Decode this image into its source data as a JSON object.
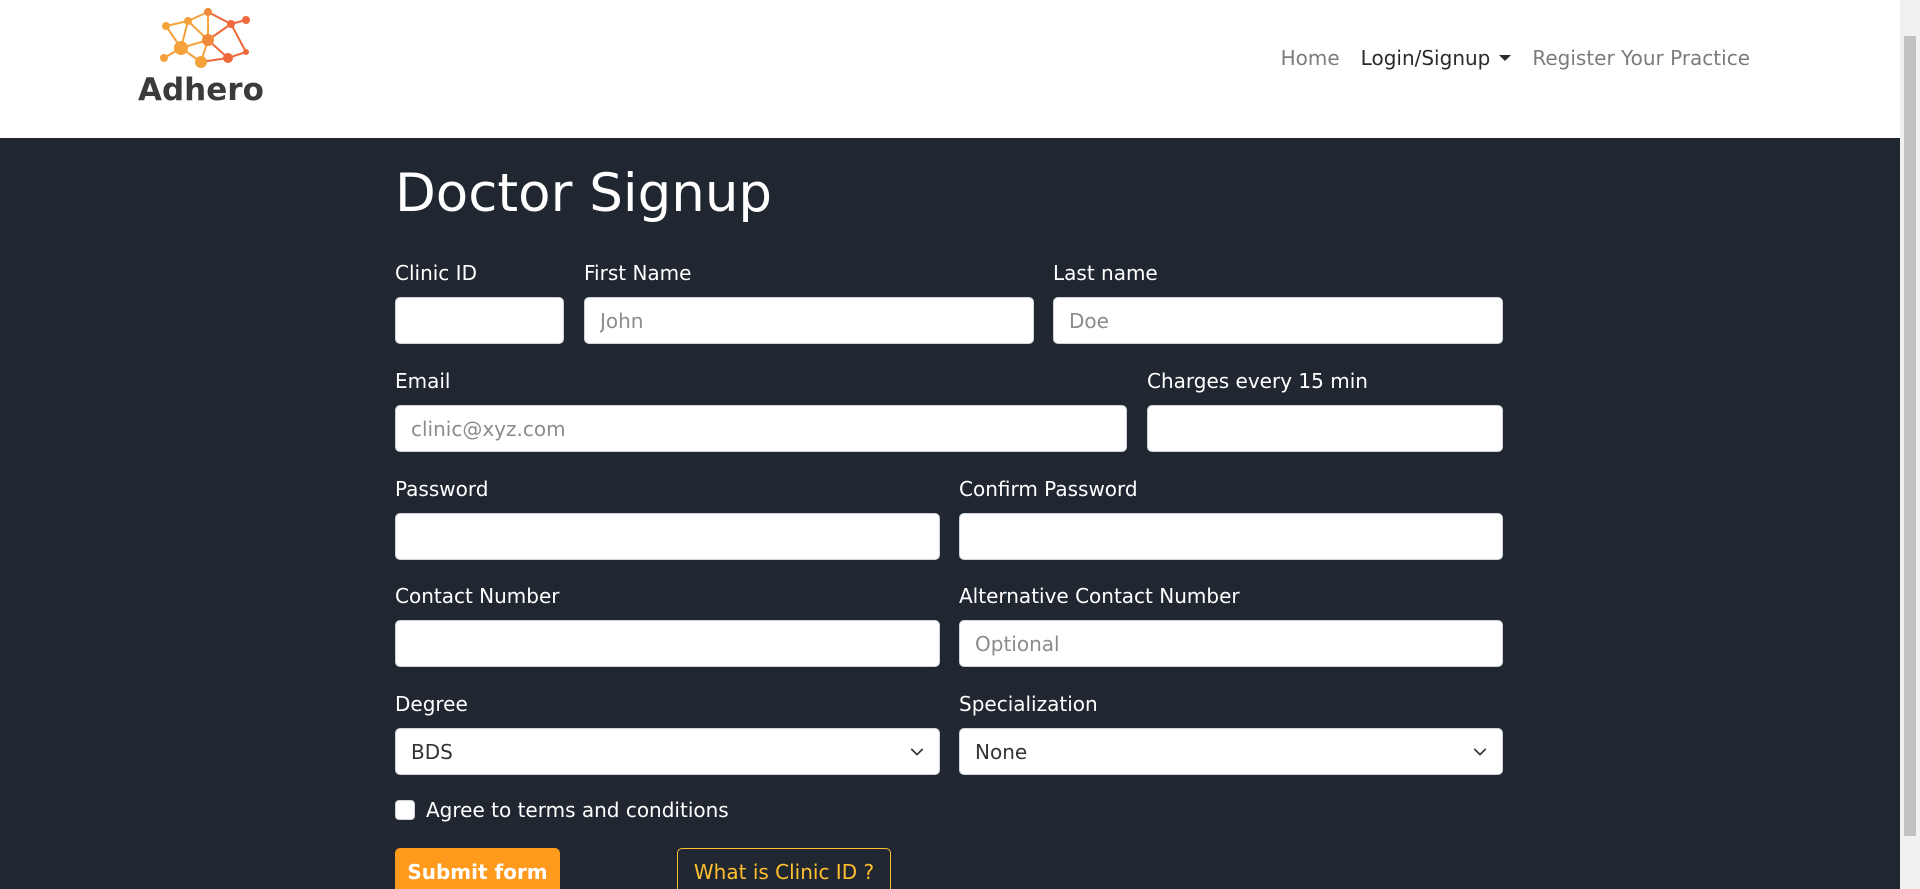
{
  "brand": {
    "name": "Adhero"
  },
  "nav": {
    "home": "Home",
    "login_signup": "Login/Signup",
    "register": "Register Your Practice"
  },
  "form": {
    "title": "Doctor Signup",
    "clinic_id": {
      "label": "Clinic ID",
      "value": "",
      "placeholder": ""
    },
    "first_name": {
      "label": "First Name",
      "placeholder": "John"
    },
    "last_name": {
      "label": "Last name",
      "placeholder": "Doe"
    },
    "email": {
      "label": "Email",
      "placeholder": "clinic@xyz.com"
    },
    "charges": {
      "label": "Charges every 15 min",
      "placeholder": ""
    },
    "password": {
      "label": "Password",
      "placeholder": ""
    },
    "confirm_password": {
      "label": "Confirm Password",
      "placeholder": ""
    },
    "contact": {
      "label": "Contact Number",
      "placeholder": ""
    },
    "alt_contact": {
      "label": "Alternative Contact Number",
      "placeholder": "Optional"
    },
    "degree": {
      "label": "Degree",
      "value": "BDS"
    },
    "specialization": {
      "label": "Specialization",
      "value": "None"
    },
    "terms": "Agree to terms and conditions",
    "submit": "Submit form",
    "what_clinic_id": "What is Clinic ID ?"
  },
  "colors": {
    "background": "#212731",
    "accent": "#ff9a1c",
    "outline_accent": "#ffbf2e"
  }
}
